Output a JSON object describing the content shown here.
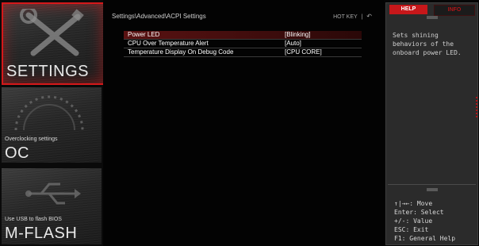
{
  "nav": {
    "settings": {
      "title": "SETTINGS",
      "icon": "tools-wrench-screwdriver-icon"
    },
    "oc": {
      "subtitle": "Overclocking settings",
      "title": "OC",
      "icon": "gauge-icon"
    },
    "mflash": {
      "subtitle": "Use USB to flash BIOS",
      "title": "M-FLASH",
      "icon": "usb-icon"
    }
  },
  "header": {
    "path": "Settings\\Advanced\\ACPI Settings",
    "hotkey_label": "HOT KEY",
    "separator": "|",
    "back_icon": "back-arrow-icon"
  },
  "settings": [
    {
      "name": "Power LED",
      "value": "[Blinking]"
    },
    {
      "name": "CPU Over Temperature Alert",
      "value": "[Auto]"
    },
    {
      "name": "Temperature Display On Debug Code",
      "value": "[CPU CORE]"
    }
  ],
  "help_panel": {
    "tabs": {
      "help": "HELP",
      "info": "INFO"
    },
    "description": "Sets shining\nbehaviors of the\nonboard power LED.",
    "keys": [
      "↑|→←: Move",
      "Enter: Select",
      "+/-: Value",
      "ESC: Exit",
      "F1: General Help"
    ]
  },
  "colors": {
    "accent": "#d5181a",
    "selected_row": "#5a1212",
    "panel_bg": "#2b2b2b"
  }
}
